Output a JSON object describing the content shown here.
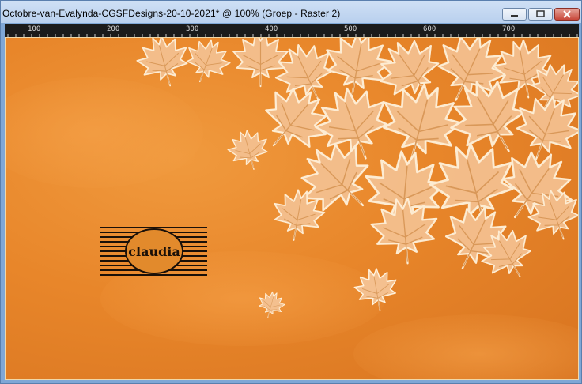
{
  "window": {
    "title": "Octobre-van-Evalynda-CGSFDesigns-20-10-2021* @ 100% (Groep - Raster 2)",
    "controls": {
      "minimize_icon": "minimize-icon",
      "maximize_icon": "maximize-icon",
      "close_icon": "close-icon"
    }
  },
  "ruler": {
    "labels": [
      "100",
      "200",
      "300",
      "400",
      "500",
      "600",
      "700"
    ]
  },
  "canvas": {
    "background_color": "#e8862a",
    "leaf_color": "#f4c08f",
    "watermark": {
      "text": "claudia"
    }
  }
}
